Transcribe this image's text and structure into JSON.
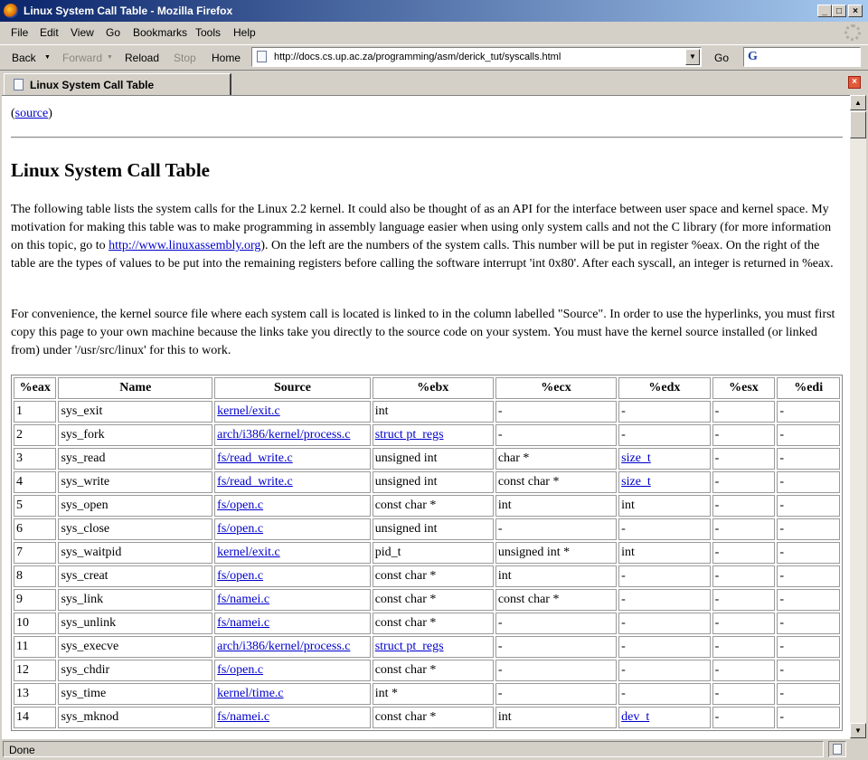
{
  "window": {
    "title": "Linux System Call Table - Mozilla Firefox",
    "min": "_",
    "max": "□",
    "close": "×"
  },
  "menu": [
    "File",
    "Edit",
    "View",
    "Go",
    "Bookmarks",
    "Tools",
    "Help"
  ],
  "nav": {
    "back": "Back",
    "forward": "Forward",
    "reload": "Reload",
    "stop": "Stop",
    "home": "Home",
    "go": "Go"
  },
  "address": {
    "url": "http://docs.cs.up.ac.za/programming/asm/derick_tut/syscalls.html"
  },
  "search": {
    "engine": "G"
  },
  "tab": {
    "title": "Linux System Call Table",
    "close": "×"
  },
  "page": {
    "source_open": "(",
    "source_link": "source",
    "source_close": ")",
    "heading": "Linux System Call Table",
    "p1_a": "The following table lists the system calls for the Linux 2.2 kernel. It could also be thought of as an API for the interface between user space and kernel space. My motivation for making this table was to make programming in assembly language easier when using only system calls and not the C library (for more information on this topic, go to ",
    "p1_link": "http://www.linuxassembly.org",
    "p1_b": "). On the left are the numbers of the system calls. This number will be put in register %eax. On the right of the table are the types of values to be put into the remaining registers before calling the software interrupt 'int 0x80'. After each syscall, an integer is returned in %eax.",
    "p2": "For convenience, the kernel source file where each system call is located is linked to in the column labelled \"Source\". In order to use the hyperlinks, you must first copy this page to your own machine because the links take you directly to the source code on your system. You must have the kernel source installed (or linked from) under '/usr/src/linux' for this to work."
  },
  "table": {
    "headers": [
      "%eax",
      "Name",
      "Source",
      "%ebx",
      "%ecx",
      "%edx",
      "%esx",
      "%edi"
    ],
    "rows": [
      [
        "1",
        "sys_exit",
        "kernel/exit.c",
        "int",
        "-",
        "-",
        "-",
        "-"
      ],
      [
        "2",
        "sys_fork",
        "arch/i386/kernel/process.c",
        "struct pt_regs",
        "-",
        "-",
        "-",
        "-"
      ],
      [
        "3",
        "sys_read",
        "fs/read_write.c",
        "unsigned int",
        "char *",
        "size_t",
        "-",
        "-"
      ],
      [
        "4",
        "sys_write",
        "fs/read_write.c",
        "unsigned int",
        "const char *",
        "size_t",
        "-",
        "-"
      ],
      [
        "5",
        "sys_open",
        "fs/open.c",
        "const char *",
        "int",
        "int",
        "-",
        "-"
      ],
      [
        "6",
        "sys_close",
        "fs/open.c",
        "unsigned int",
        "-",
        "-",
        "-",
        "-"
      ],
      [
        "7",
        "sys_waitpid",
        "kernel/exit.c",
        "pid_t",
        "unsigned int *",
        "int",
        "-",
        "-"
      ],
      [
        "8",
        "sys_creat",
        "fs/open.c",
        "const char *",
        "int",
        "-",
        "-",
        "-"
      ],
      [
        "9",
        "sys_link",
        "fs/namei.c",
        "const char *",
        "const char *",
        "-",
        "-",
        "-"
      ],
      [
        "10",
        "sys_unlink",
        "fs/namei.c",
        "const char *",
        "-",
        "-",
        "-",
        "-"
      ],
      [
        "11",
        "sys_execve",
        "arch/i386/kernel/process.c",
        "struct pt_regs",
        "-",
        "-",
        "-",
        "-"
      ],
      [
        "12",
        "sys_chdir",
        "fs/open.c",
        "const char *",
        "-",
        "-",
        "-",
        "-"
      ],
      [
        "13",
        "sys_time",
        "kernel/time.c",
        "int *",
        "-",
        "-",
        "-",
        "-"
      ],
      [
        "14",
        "sys_mknod",
        "fs/namei.c",
        "const char *",
        "int",
        "dev_t",
        "-",
        "-"
      ]
    ],
    "link_cells": {
      "ebx": [
        "struct pt_regs"
      ],
      "edx": [
        "size_t",
        "dev_t"
      ]
    }
  },
  "status": {
    "text": "Done"
  }
}
